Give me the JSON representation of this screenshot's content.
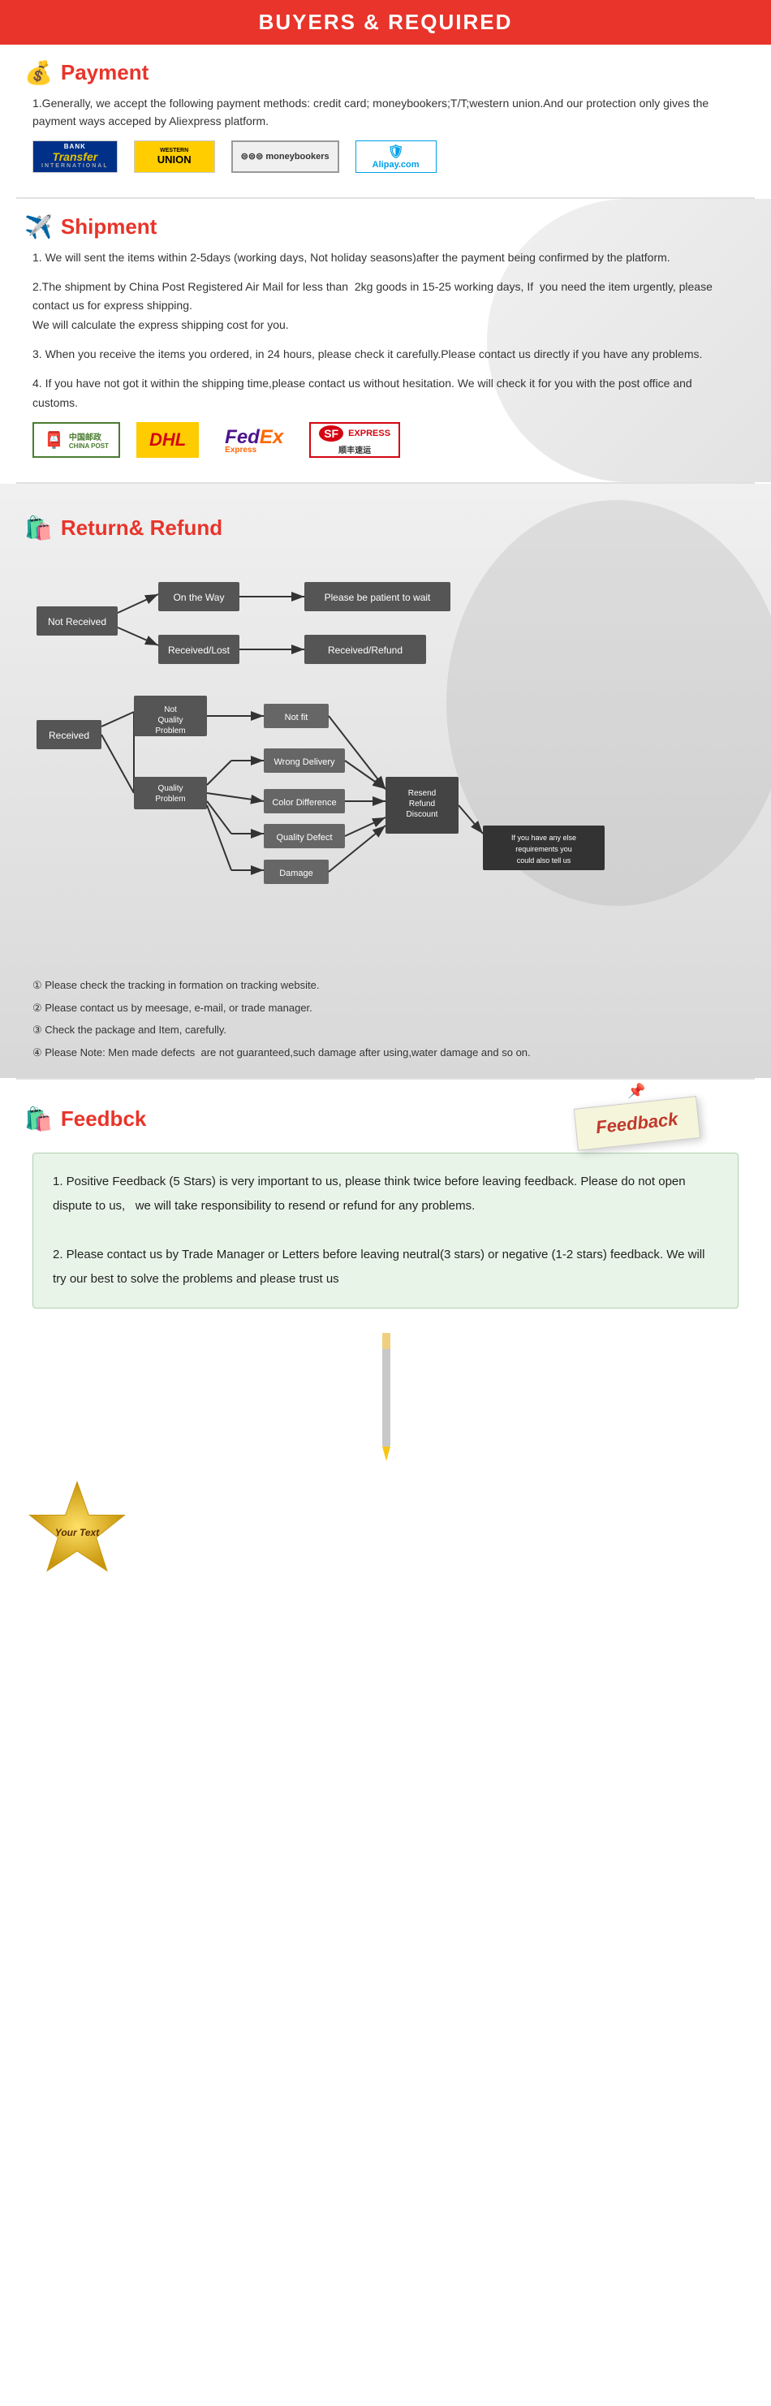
{
  "header": {
    "title": "BUYERS & REQUIRED"
  },
  "payment": {
    "section_title": "Payment",
    "section_icon": "💰",
    "description": "1.Generally, we accept the following payment methods: credit card; moneybookers;T/T;western union.And our protection only gives the payment ways acceped by Aliexpress platform.",
    "logos": [
      {
        "id": "bank-transfer",
        "label": "BANK TRANSFER INTERNATIONAL",
        "type": "bank"
      },
      {
        "id": "western-union",
        "label": "WESTERN UNION",
        "type": "wu"
      },
      {
        "id": "moneybookers",
        "label": "moneybookers",
        "type": "mb"
      },
      {
        "id": "alipay",
        "label": "Alipay.com",
        "type": "ali"
      }
    ]
  },
  "shipment": {
    "section_title": "Shipment",
    "section_icon": "✈️",
    "points": [
      "1. We will sent the items within 2-5days (working days, Not holiday seasons)after the payment being confirmed by the platform.",
      "2.The shipment by China Post Registered Air Mail for less than  2kg goods in 15-25 working days, If  you need the item urgently, please contact us for express shipping.\nWe will calculate the express shipping cost for you.",
      "3. When you receive the items you ordered, in 24 hours, please check it carefully.Please contact us directly if you have any problems.",
      "4. If you have not got it within the shipping time,please contact us without hesitation. We will check it for you with the post office and customs."
    ],
    "couriers": [
      {
        "id": "chinapost",
        "label": "中国邮政\nCHINA POST"
      },
      {
        "id": "dhl",
        "label": "DHL"
      },
      {
        "id": "fedex",
        "label": "FedEx Express"
      },
      {
        "id": "sf",
        "label": "SF EXPRESS 顺丰速运"
      }
    ]
  },
  "refund": {
    "section_title": "Return& Refund",
    "section_icon": "🛍️",
    "flow": {
      "not_received": "Not Received",
      "on_the_way": "On the Way",
      "please_wait": "Please be patient to wait",
      "received_lost": "Received/Lost",
      "received_refund": "Received/Refund",
      "received": "Received",
      "not_quality_problem": "Not Quality Problem",
      "not_fit": "Not fit",
      "wrong_delivery": "Wrong Delivery",
      "quality_problem": "Quality Problem",
      "color_difference": "Color Difference",
      "quality_defect": "Quality Defect",
      "damage": "Damage",
      "resend_refund_discount": "Resend\nRefund\nDiscount",
      "if_else": "If you have any else requirements you could also tell us"
    },
    "notes": [
      "① Please check the tracking in formation on tracking website.",
      "② Please contact us by meesage, e-mail, or trade manager.",
      "③ Check the package and Item, carefully.",
      "④ Please Note: Men made defects  are not guaranteed,such damage after using,water damage and so on."
    ]
  },
  "feedback": {
    "section_title": "Feedbck",
    "section_icon": "🛍️",
    "card_label": "Feedback",
    "points": [
      "1. Positive Feedback (5 Stars) is very important to us, please think twice before leaving feedback. Please do not open dispute to us,   we will take responsibility to resend or refund for any problems.",
      "2. Please contact us by Trade Manager or Letters before leaving neutral(3 stars) or negative (1-2 stars) feedback. We will try our best to solve the problems and please trust us"
    ]
  },
  "badge": {
    "text": "Your Text"
  }
}
